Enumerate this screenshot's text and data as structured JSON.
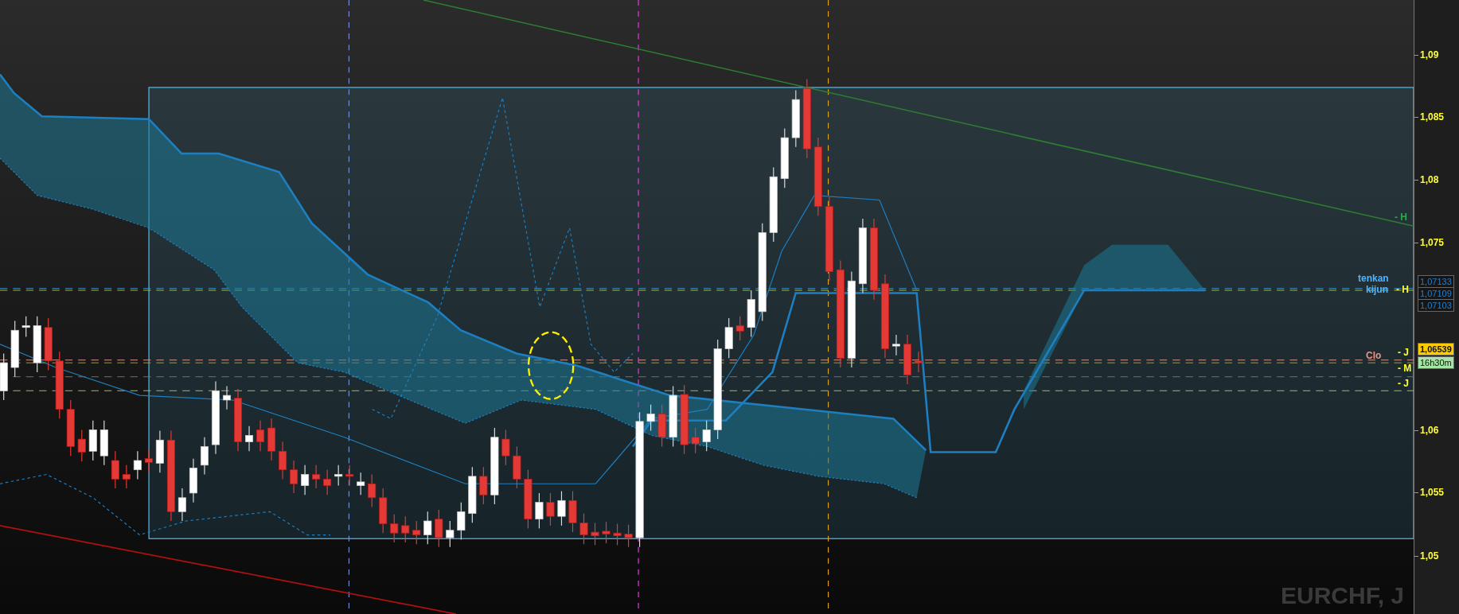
{
  "chart": {
    "symbol": "EURCHF, J",
    "line_labels": [
      {
        "text": "- H",
        "color": "#2ea84a"
      },
      {
        "text": "tenkan",
        "color": "#4fb3ff"
      },
      {
        "text": "kijun",
        "color": "#4fb3ff"
      },
      {
        "text": "- H",
        "color": "#ffff33"
      },
      {
        "text": "Clo",
        "color": "#e8968a"
      },
      {
        "text": "- J",
        "color": "#ffff33"
      },
      {
        "text": "- M",
        "color": "#ffff33"
      },
      {
        "text": "- J",
        "color": "#ffff33"
      }
    ],
    "axis": {
      "ticks": [
        "1,09",
        "1,085",
        "1,08",
        "1,075",
        "1,06",
        "1,055",
        "1,05"
      ]
    },
    "price_tags": [
      {
        "text": "1,07133",
        "kind": "line"
      },
      {
        "text": "1,07109",
        "kind": "line"
      },
      {
        "text": "1,07103",
        "kind": "line"
      },
      {
        "text": "1,06539",
        "kind": "price"
      },
      {
        "text": "16h30m",
        "kind": "timer"
      }
    ]
  }
}
